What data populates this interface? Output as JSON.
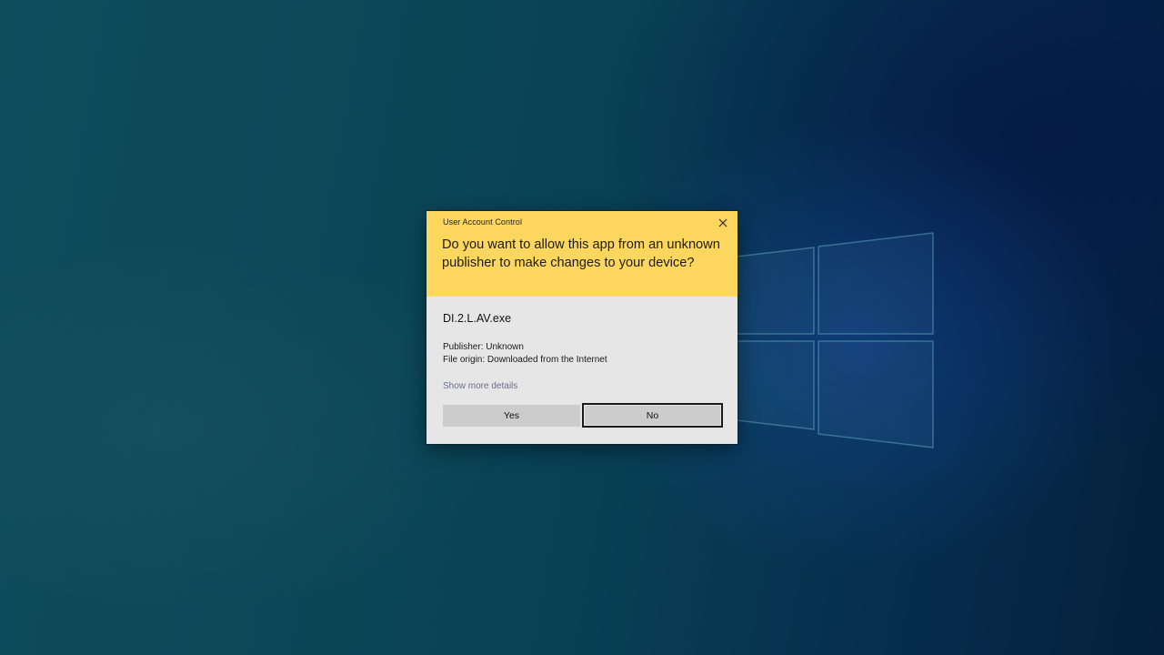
{
  "dialog": {
    "title": "User Account Control",
    "question": "Do you want to allow this app from an unknown publisher to make changes to your device?",
    "app_name": "DI.2.L.AV.exe",
    "publisher": "Publisher: Unknown",
    "file_origin": "File origin: Downloaded from the Internet",
    "details_link": "Show more details",
    "yes_label": "Yes",
    "no_label": "No"
  },
  "colors": {
    "header_yellow": "#fdd75d",
    "body_gray": "#e6e6e6",
    "button_gray": "#cccccc",
    "desktop_teal": "#0b4657"
  },
  "icons": {
    "close": "close-icon",
    "background_logo": "windows-logo-icon"
  }
}
